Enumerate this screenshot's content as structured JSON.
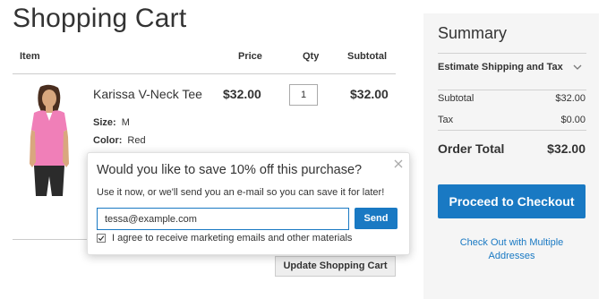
{
  "page": {
    "title": "Shopping Cart"
  },
  "cart": {
    "headers": {
      "item": "Item",
      "price": "Price",
      "qty": "Qty",
      "subtotal": "Subtotal"
    },
    "item": {
      "name": "Karissa V-Neck Tee",
      "price": "$32.00",
      "qty": "1",
      "subtotal": "$32.00",
      "options": {
        "size_label": "Size:",
        "size_value": "M",
        "color_label": "Color:",
        "color_value": "Red"
      }
    },
    "update_button": "Update Shopping Cart"
  },
  "summary": {
    "title": "Summary",
    "estimate_shipping": "Estimate Shipping and Tax",
    "rows": [
      {
        "label": "Subtotal",
        "value": "$32.00"
      },
      {
        "label": "Tax",
        "value": "$0.00"
      }
    ],
    "order_total_label": "Order Total",
    "order_total_value": "$32.00",
    "checkout_button": "Proceed to Checkout",
    "multi_address_link": "Check Out with Multiple Addresses"
  },
  "popup": {
    "title": "Would you like to save 10% off this purchase?",
    "text": "Use it now, or we'll send you an e-mail so you can save it for later!",
    "email_value": "tessa@example.com",
    "send_button": "Send",
    "consent_label": "I agree to receive marketing emails and other materials",
    "consent_checked": true
  },
  "colors": {
    "accent": "#1979c3",
    "summary_bg": "#f5f5f5",
    "product_shirt": "#f07fb8"
  },
  "icons": {
    "close": "close-icon",
    "chevron": "chevron-down-icon",
    "check": "checkmark-icon"
  }
}
